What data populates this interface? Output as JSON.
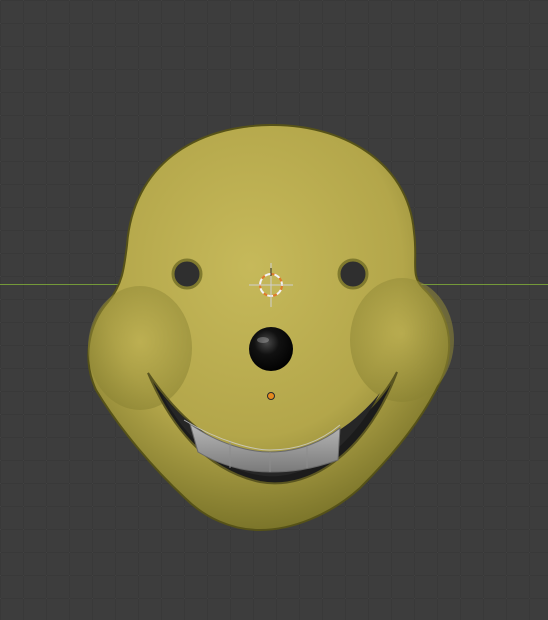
{
  "viewport": {
    "background_color": "#3d3d3d",
    "grid_color": "#2f2f2f",
    "x_axis_color": "#7aa338"
  },
  "model": {
    "object": "smiley-mask",
    "skin_color": "#b7aa4c",
    "skin_shadow_color": "#6f6a23",
    "nose_color": "#0f0f0f",
    "mouth_color": "#1a1a1a",
    "teeth_color": "#9b9b9b",
    "origin_color": "#e68a1e"
  },
  "tools": {
    "cursor_3d": "3d-cursor-icon",
    "origin": "object-origin-icon"
  }
}
